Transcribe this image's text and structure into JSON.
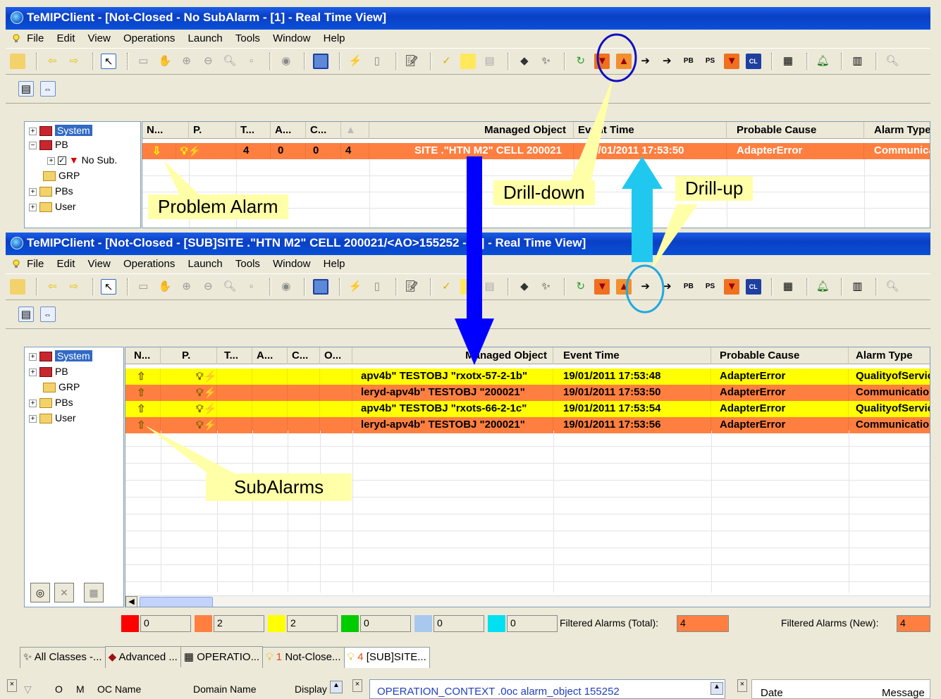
{
  "window1": {
    "title": "TeMIPClient - [Not-Closed - No SubAlarm - [1] - Real Time View]",
    "menu": [
      "File",
      "Edit",
      "View",
      "Operations",
      "Launch",
      "Tools",
      "Window",
      "Help"
    ],
    "tree": [
      {
        "label": "System",
        "selected": true
      },
      {
        "label": "PB"
      },
      {
        "label": "No Sub."
      },
      {
        "label": "GRP"
      },
      {
        "label": "PBs"
      },
      {
        "label": "User"
      }
    ],
    "columns": [
      "N...",
      "P.",
      "T...",
      "A...",
      "C...",
      "",
      "Managed Object",
      "Event Time",
      "Probable Cause",
      "Alarm Type"
    ],
    "row": {
      "t": "4",
      "a": "0",
      "c": "0",
      "o": "4",
      "managed_object": "SITE .\"HTN M2\" CELL 200021",
      "event_time": "19/01/2011 17:53:50",
      "probable_cause": "AdapterError",
      "alarm_type": "Communication"
    }
  },
  "window2": {
    "title": "TeMIPClient - [Not-Closed - [SUB]SITE .\"HTN M2\" CELL 200021/<AO>155252 - [4] - Real Time View]",
    "menu": [
      "File",
      "Edit",
      "View",
      "Operations",
      "Launch",
      "Tools",
      "Window",
      "Help"
    ],
    "tree": [
      {
        "label": "System",
        "selected": true
      },
      {
        "label": "PB"
      },
      {
        "label": "GRP"
      },
      {
        "label": "PBs"
      },
      {
        "label": "User"
      }
    ],
    "columns": [
      "N...",
      "P.",
      "T...",
      "A...",
      "C...",
      "O...",
      "Managed Object",
      "Event Time",
      "Probable Cause",
      "Alarm Type"
    ],
    "rows": [
      {
        "color": "#ffff00",
        "managed_object": "apv4b\" TESTOBJ \"rxotx-57-2-1b\"",
        "event_time": "19/01/2011 17:53:48",
        "probable_cause": "AdapterError",
        "alarm_type": "QualityofService"
      },
      {
        "color": "#ff7f40",
        "managed_object": "leryd-apv4b\" TESTOBJ \"200021\"",
        "event_time": "19/01/2011 17:53:50",
        "probable_cause": "AdapterError",
        "alarm_type": "Communication"
      },
      {
        "color": "#ffff00",
        "managed_object": "apv4b\" TESTOBJ \"rxots-66-2-1c\"",
        "event_time": "19/01/2011 17:53:54",
        "probable_cause": "AdapterError",
        "alarm_type": "QualityofService"
      },
      {
        "color": "#ff7f40",
        "managed_object": "leryd-apv4b\" TESTOBJ \"200021\"",
        "event_time": "19/01/2011 17:53:56",
        "probable_cause": "AdapterError",
        "alarm_type": "Communication"
      }
    ],
    "severity_counts": [
      {
        "color": "#ff0000",
        "value": "0"
      },
      {
        "color": "#ff7f40",
        "value": "2"
      },
      {
        "color": "#ffff00",
        "value": "2"
      },
      {
        "color": "#00cc00",
        "value": "0"
      },
      {
        "color": "#a8c8f0",
        "value": "0"
      },
      {
        "color": "#00e0f0",
        "value": "0"
      }
    ],
    "filtered_total_label": "Filtered Alarms (Total):",
    "filtered_total_value": "4",
    "filtered_new_label": "Filtered Alarms (New):",
    "filtered_new_value": "4"
  },
  "tabs": [
    {
      "label": "All Classes -..."
    },
    {
      "label": "Advanced ..."
    },
    {
      "label": "OPERATIO..."
    },
    {
      "prefix": "1",
      "label": "Not-Close..."
    },
    {
      "prefix": "4",
      "label": "[SUB]SITE...",
      "active": true
    }
  ],
  "bottom": {
    "columns": [
      "O",
      "M",
      "OC Name",
      "Domain Name",
      "Display"
    ],
    "context": "OPERATION_CONTEXT .0oc alarm_object 155252",
    "right_columns": [
      "Date",
      "Message"
    ]
  },
  "callouts": {
    "problem_alarm": "Problem Alarm",
    "drill_down": "Drill-down",
    "drill_up": "Drill-up",
    "subalarms": "SubAlarms"
  },
  "colors": {
    "titlebar": "#0a3fc4",
    "orange": "#ff7f40",
    "yellow": "#ffff00",
    "arrow_down": "#0000ff",
    "arrow_up": "#20c8f0"
  }
}
